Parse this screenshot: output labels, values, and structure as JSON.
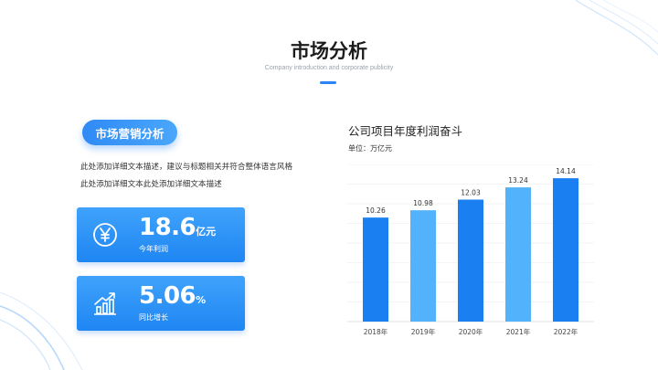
{
  "header": {
    "title": "市场分析",
    "subtitle": "Company introduction and corporate publicity"
  },
  "left": {
    "pill_label": "市场营销分析",
    "description": "此处添加详细文本描述，建议与标题相关并符合整体语言风格此处添加详细文本此处添加详细文本描述"
  },
  "stats": [
    {
      "value": "18.6",
      "unit": "亿元",
      "label": "今年利润",
      "icon": "yen-icon"
    },
    {
      "value": "5.06",
      "unit": "%",
      "label": "同比增长",
      "icon": "growth-chart-icon"
    }
  ],
  "chart_data": {
    "type": "bar",
    "title": "公司项目年度利润奋斗",
    "unit_label": "单位：万亿元",
    "categories": [
      "2018年",
      "2019年",
      "2020年",
      "2021年",
      "2022年"
    ],
    "values": [
      10.26,
      10.98,
      12.03,
      13.24,
      14.14
    ],
    "value_labels": [
      "10.26",
      "10.98",
      "12.03",
      "13.24",
      "14.14"
    ],
    "bar_colors": [
      "#1a7ff0",
      "#52b2fb",
      "#1a7ff0",
      "#52b2fb",
      "#1a7ff0"
    ],
    "ylim": [
      0,
      15.5
    ],
    "grid": true
  },
  "colors": {
    "accent": "#2b86f4",
    "bar_dark": "#1a7ff0",
    "bar_light": "#52b2fb"
  }
}
